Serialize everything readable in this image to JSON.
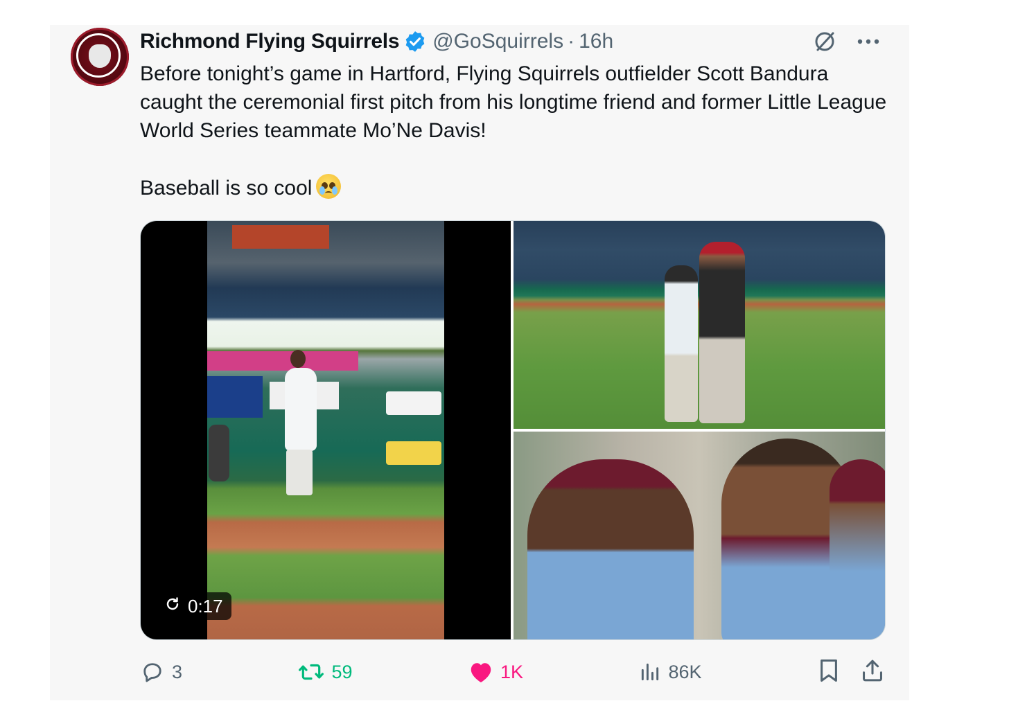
{
  "tweet": {
    "author": {
      "display_name": "Richmond Flying Squirrels",
      "handle": "@GoSquirrels",
      "separator": "·",
      "time": "16h",
      "verified": true,
      "avatar_icon": "flying-squirrels-logo"
    },
    "text": {
      "paragraph1": "Before tonight’s game in Hartford, Flying Squirrels outfielder Scott Bandura caught the ceremonial first pitch from his longtime friend and former Little League World Series teammate Mo’Ne Davis!",
      "paragraph2": "Baseball is so cool",
      "emoji": "face-holding-back-tears-emoji"
    },
    "media": {
      "video": {
        "duration": "0:17",
        "icon": "replay-icon"
      },
      "photo_count": 2
    },
    "actions": {
      "replies": "3",
      "retweets": "59",
      "likes": "1K",
      "views": "86K"
    },
    "top_icons": [
      "grok-slash-icon",
      "more-icon"
    ],
    "colors": {
      "verified": "#1d9bf0",
      "retweet": "#00ba7c",
      "like": "#f91880",
      "muted": "#536471",
      "background": "#f7f7f7"
    }
  }
}
